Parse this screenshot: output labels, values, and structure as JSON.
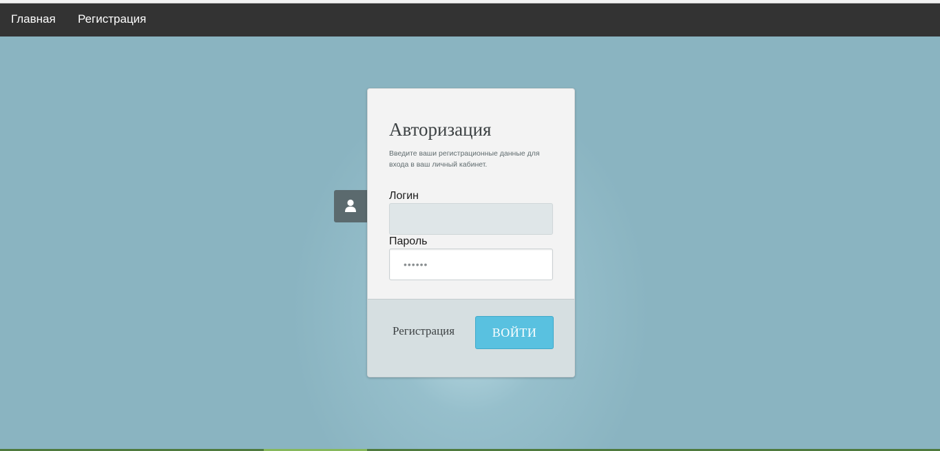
{
  "nav": {
    "home_label": "Главная",
    "register_label": "Регистрация"
  },
  "login_card": {
    "title": "Авторизация",
    "subtitle": "Введите ваши регистрационные данные для входа в ваш личный кабинет.",
    "login_label": "Логин",
    "login_value": "",
    "password_label": "Пароль",
    "password_value": "••••••",
    "register_link": "Регистрация",
    "submit_label": "ВОЙТИ"
  },
  "icons": {
    "user_tab": "user-icon"
  },
  "colors": {
    "navbar": "#333333",
    "background": "#8ab4c1",
    "accent_button": "#59c1e0",
    "user_tab": "#5b6a6e"
  }
}
